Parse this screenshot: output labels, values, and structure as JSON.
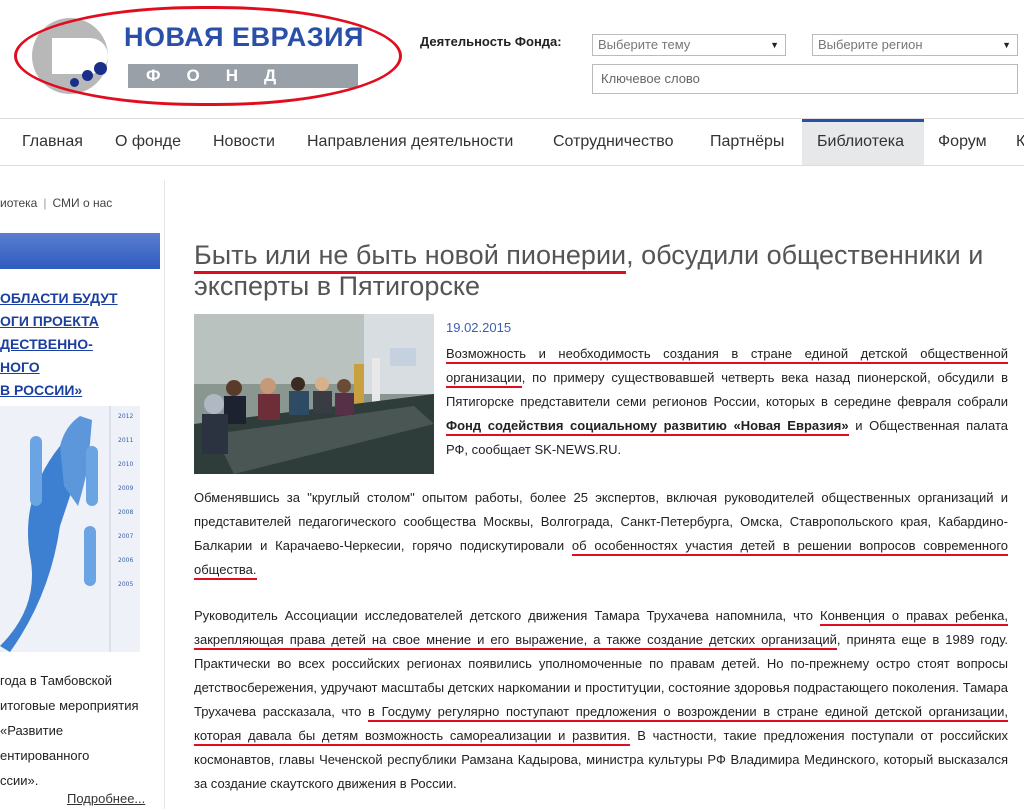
{
  "header": {
    "logo_title": "НОВАЯ ЕВРАЗИЯ",
    "logo_sub": "ФОНД",
    "activity_label": "Деятельность Фонда:",
    "topic_select": "Выберите тему",
    "region_select": "Выберите регион",
    "keyword_placeholder": "Ключевое слово"
  },
  "nav": [
    "Главная",
    "О фонде",
    "Новости",
    "Направления деятельности",
    "Сотрудничество",
    "Партнёры",
    "Библиотека",
    "Форум",
    "К"
  ],
  "breadcrumb": [
    "иотека",
    "СМИ о нас"
  ],
  "sidebar": {
    "links": [
      "ОБЛАСТИ БУДУТ",
      "ОГИ ПРОЕКТА",
      "ДЕСТВЕННО-",
      "НОГО",
      "В РОССИИ»"
    ],
    "years": [
      "2012",
      "2011",
      "2010",
      "2009",
      "2008",
      "2007",
      "2006",
      "2005"
    ],
    "text": [
      "года в Тамбовской",
      "итоговые мероприятия",
      "«Развитие",
      "ентированного",
      "ссии»."
    ],
    "more": "Подробнее..."
  },
  "article": {
    "title_a": "Быть или не быть новой пионерии",
    "title_b": ", обсудили общественники и эксперты в Пятигорске",
    "date": "19.02.2015",
    "p1": {
      "u1": "Возможность и необходимость создания в стране единой детской общественной организации",
      "t1": ", по примеру существовавшей четверть века назад пионерской, обсудили в Пятигорске представители семи регионов России, которых в середине февраля собрали ",
      "b1": "Фонд содействия социальному развитию «Новая Евразия»",
      "t2": " и Общественная палата РФ, сообщает SK-NEWS.RU."
    },
    "p2": {
      "t1": "Обменявшись за \"круглый столом\" опытом работы, более 25 экспертов, включая руководителей общественных организаций и представителей педагогического сообщества Москвы, Волгограда, Санкт-Петербурга, Омска, Ставропольского края, Кабардино-Балкарии и Карачаево-Черкесии, горячо подискутировали ",
      "u1": "об особенностях участия детей в решении вопросов современного общества."
    },
    "p3": {
      "t1": "Руководитель Ассоциации исследователей детского движения Тамара Трухачева напомнила, что ",
      "u1": "Конвенция о правах ребенка, закрепляющая права детей на свое мнение и его выражение, а также создание детских организаций",
      "t2": ", принята еще в 1989 году. Практически во всех российских регионах появились уполномоченные по правам детей. Но по-прежнему остро стоят вопросы детствосбережения, удручают масштабы детских наркомании и проституции, состояние здоровья подрастающего поколения. Тамара Трухачева рассказала, что ",
      "u2": "в Госдуму регулярно поступают предложения о возрождении в стране единой детской организации, которая давала бы детям возможность самореализации и развития.",
      "t3": " В частности, такие предложения поступали от российских космонавтов, главы Чеченской республики Рамзана Кадырова, министра культуры РФ Владимира Мединского, который высказался за создание скаутского движения в России."
    }
  },
  "colors": {
    "accent": "#2a4fa8",
    "annotation": "#e10d1e"
  }
}
